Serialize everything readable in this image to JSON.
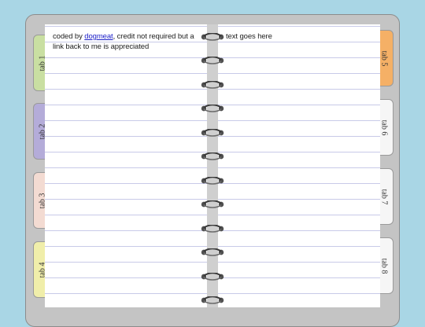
{
  "tabs_left": [
    {
      "label": "tab 1",
      "color": "#c9dfa2"
    },
    {
      "label": "tab 2",
      "color": "#b4acd9"
    },
    {
      "label": "tab 3",
      "color": "#f3dbd2"
    },
    {
      "label": "tab 4",
      "color": "#f0eeaa"
    }
  ],
  "tabs_right": [
    {
      "label": "tab 5",
      "color": "#f5b066"
    },
    {
      "label": "tab 6",
      "color": "#f6f6f6"
    },
    {
      "label": "tab 7",
      "color": "#f6f6f6"
    },
    {
      "label": "tab 8",
      "color": "#f6f6f6"
    }
  ],
  "left_page": {
    "text_before": "coded by ",
    "link_text": "dogmeat",
    "text_after": ", credit not required but a link back to me is appreciated"
  },
  "right_page": {
    "text": "text goes here"
  },
  "colors": {
    "background": "#a9d6e5",
    "binder": "#c4c4c4",
    "rule_line": "#c8cae8",
    "link": "#1f22c9"
  },
  "icons": [
    "binder-ring-icon"
  ]
}
